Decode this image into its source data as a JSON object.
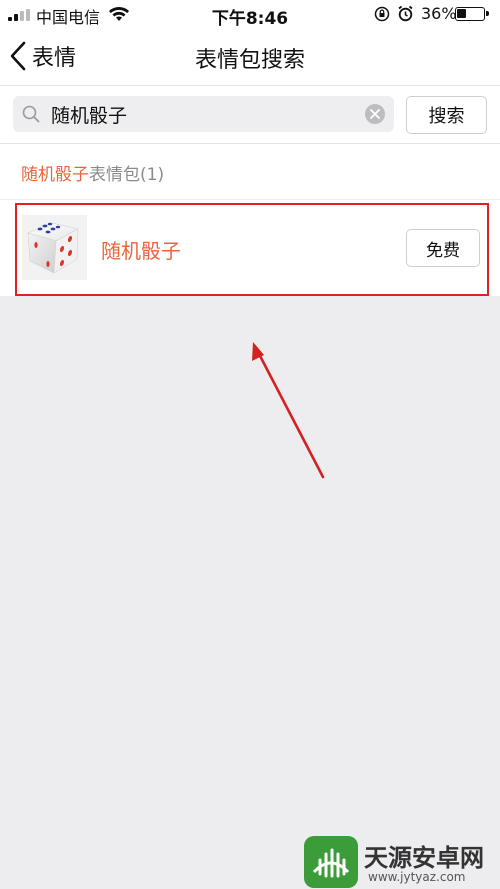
{
  "status_bar": {
    "carrier": "中国电信",
    "time": "下午8:46",
    "battery_percent": "36%",
    "battery_level": 0.36,
    "icons": [
      "signal-icon",
      "wifi-icon",
      "rotation-lock-icon",
      "alarm-icon",
      "battery-icon"
    ]
  },
  "nav": {
    "back_label": "表情",
    "title": "表情包搜索"
  },
  "search": {
    "value": "随机骰子",
    "button_label": "搜索"
  },
  "results_section": {
    "keyword": "随机骰子",
    "suffix": "表情包(1)"
  },
  "results": [
    {
      "name": "随机骰子",
      "action_label": "免费",
      "thumb_icon": "dice-icon"
    }
  ],
  "watermark": {
    "text": "天源安卓网",
    "url": "www.jytyaz.com"
  },
  "colors": {
    "accent": "#e8663a",
    "highlight": "#e02020",
    "background": "#ededf0"
  }
}
